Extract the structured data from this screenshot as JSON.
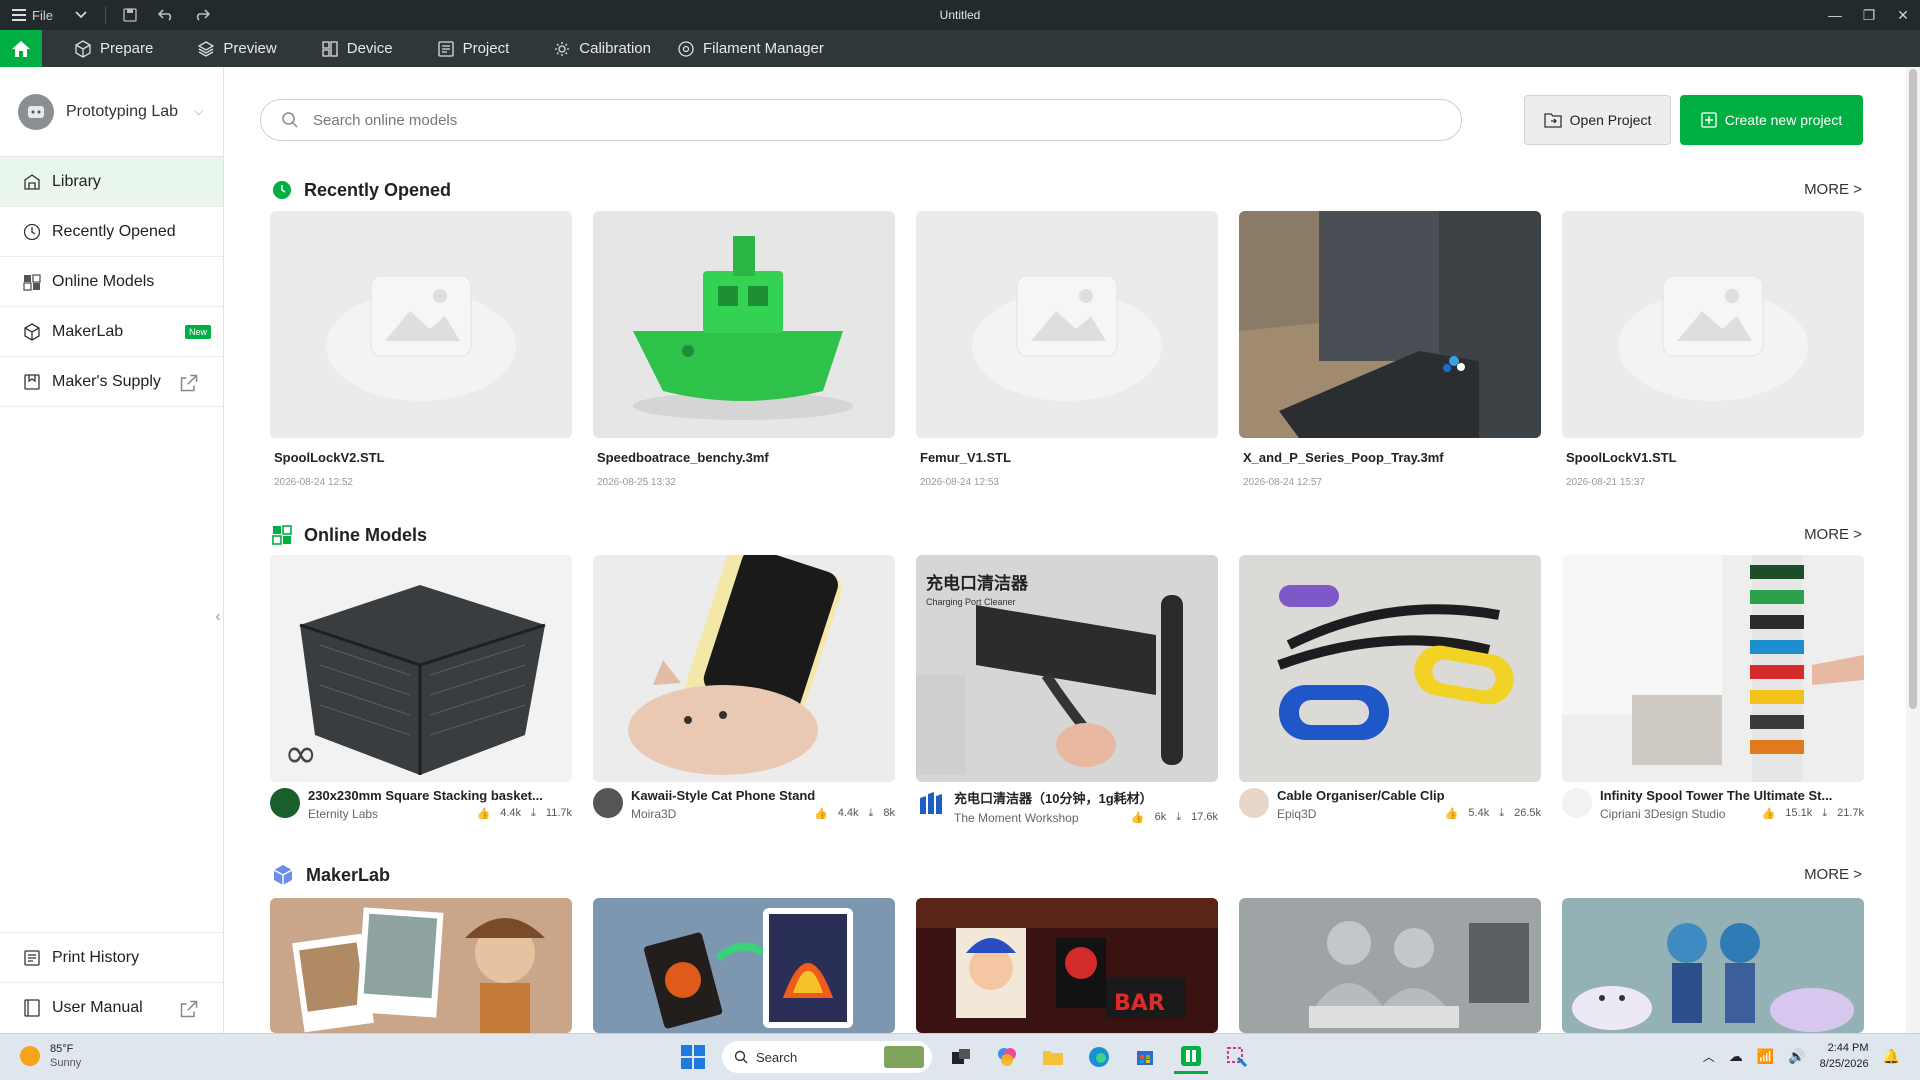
{
  "window": {
    "file_label": "File",
    "title": "Untitled"
  },
  "nav": {
    "items": [
      {
        "label": "Prepare",
        "icon": "cube-icon"
      },
      {
        "label": "Preview",
        "icon": "layers-icon"
      },
      {
        "label": "Device",
        "icon": "device-icon"
      },
      {
        "label": "Project",
        "icon": "project-icon"
      },
      {
        "label": "Calibration",
        "icon": "gear-icon"
      },
      {
        "label": "Filament Manager",
        "icon": "filament-icon"
      }
    ]
  },
  "sidebar": {
    "profile_name": "Prototyping Lab",
    "items": [
      {
        "label": "Library"
      },
      {
        "label": "Recently Opened"
      },
      {
        "label": "Online Models"
      },
      {
        "label": "MakerLab",
        "badge": "New"
      },
      {
        "label": "Maker's Supply"
      }
    ],
    "bottom_items": [
      {
        "label": "Print History"
      },
      {
        "label": "User Manual"
      }
    ]
  },
  "search": {
    "placeholder": "Search online models"
  },
  "actions": {
    "open_project": "Open Project",
    "create_project": "Create new project"
  },
  "sections": {
    "recent": {
      "title": "Recently Opened",
      "more": "MORE >"
    },
    "online": {
      "title": "Online Models",
      "more": "MORE >"
    },
    "makerlab": {
      "title": "MakerLab",
      "more": "MORE >"
    }
  },
  "recent": [
    {
      "name": "SpoolLockV2.STL",
      "date": "2026-08-24 12:52"
    },
    {
      "name": "Speedboatrace_benchy.3mf",
      "date": "2026-08-25 13:32"
    },
    {
      "name": "Femur_V1.STL",
      "date": "2026-08-24 12:53"
    },
    {
      "name": "X_and_P_Series_Poop_Tray.3mf",
      "date": "2026-08-24 12:57"
    },
    {
      "name": "SpoolLockV1.STL",
      "date": "2026-08-21 15:37"
    }
  ],
  "online_models": [
    {
      "title": "230x230mm Square Stacking basket...",
      "creator": "Eternity Labs",
      "likes": "4.4k",
      "downloads": "11.7k"
    },
    {
      "title": "Kawaii-Style Cat Phone Stand",
      "creator": "Moira3D",
      "likes": "4.4k",
      "downloads": "8k"
    },
    {
      "title": "充电口清洁器（10分钟，1g耗材）",
      "creator": "The Moment Workshop",
      "likes": "6k",
      "downloads": "17.6k"
    },
    {
      "title": "Cable Organiser/Cable Clip",
      "creator": "Epiq3D",
      "likes": "5.4k",
      "downloads": "26.5k"
    },
    {
      "title": "Infinity Spool Tower The Ultimate St...",
      "creator": "Cipriani 3Design Studio",
      "likes": "15.1k",
      "downloads": "21.7k"
    }
  ],
  "thumb_text": {
    "charger_cn": "充电口清洁器",
    "charger_en": "Charging Port Cleaner"
  },
  "taskbar": {
    "temp": "85°F",
    "condition": "Sunny",
    "search_label": "Search",
    "time": "2:44 PM",
    "date": "8/25/2026"
  },
  "colors": {
    "accent": "#00ae42",
    "titlebar": "#232a2d",
    "topnav": "#2f373a"
  }
}
